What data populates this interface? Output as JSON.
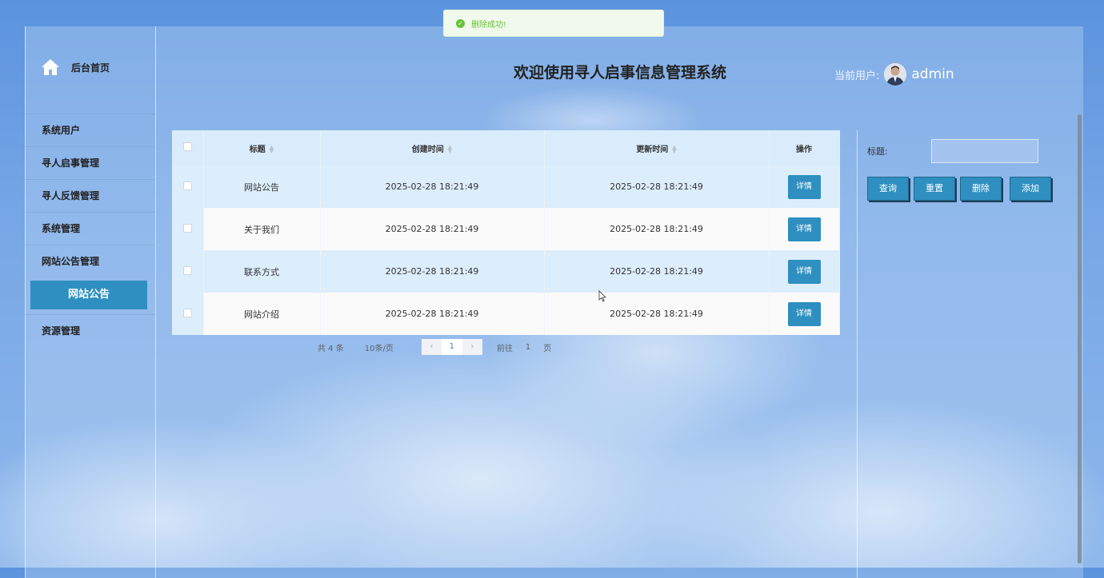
{
  "toast": {
    "text": "删除成功!",
    "icon": "success-check-icon",
    "color": "#67c23a"
  },
  "sidebar": {
    "home_label": "后台首页",
    "items": [
      {
        "label": "系统用户"
      },
      {
        "label": "寻人启事管理"
      },
      {
        "label": "寻人反馈管理"
      },
      {
        "label": "系统管理"
      },
      {
        "label": "网站公告管理"
      }
    ],
    "active_sub": "网站公告",
    "last_item": "资源管理"
  },
  "header": {
    "title": "欢迎使用寻人启事信息管理系统",
    "user_label": "当前用户:",
    "user_name": "admin"
  },
  "table": {
    "headers": {
      "title": "标题",
      "created": "创建时间",
      "updated": "更新时间",
      "action": "操作"
    },
    "rows": [
      {
        "title": "网站公告",
        "created": "2025-02-28 18:21:49",
        "updated": "2025-02-28 18:21:49",
        "action": "详情"
      },
      {
        "title": "关于我们",
        "created": "2025-02-28 18:21:49",
        "updated": "2025-02-28 18:21:49",
        "action": "详情"
      },
      {
        "title": "联系方式",
        "created": "2025-02-28 18:21:49",
        "updated": "2025-02-28 18:21:49",
        "action": "详情"
      },
      {
        "title": "网站介绍",
        "created": "2025-02-28 18:21:49",
        "updated": "2025-02-28 18:21:49",
        "action": "详情"
      }
    ]
  },
  "pagination": {
    "total": "共 4 条",
    "page_size": "10条/页",
    "current": "1",
    "goto_prefix": "前往",
    "goto_value": "1",
    "goto_suffix": "页"
  },
  "search": {
    "label": "标题:",
    "value": "",
    "buttons": {
      "query": "查询",
      "reset": "重置",
      "delete": "删除",
      "add": "添加"
    }
  },
  "colors": {
    "accent": "#2e8fc0",
    "header_bg": "#d9ecfb"
  }
}
